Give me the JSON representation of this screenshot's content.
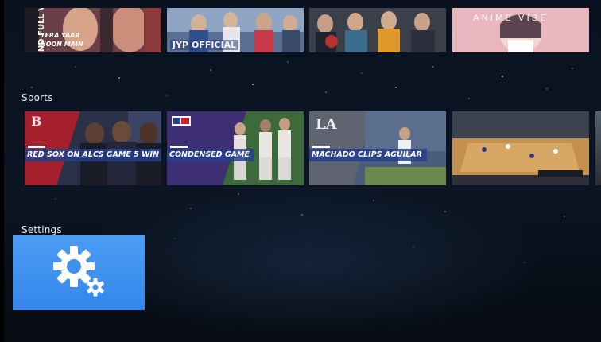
{
  "rows": [
    {
      "title": "",
      "tiles": [
        {
          "name": "movie-poster",
          "texts": [
            "ND FULL V",
            "TERA YAAR",
            "HOON MAIN"
          ]
        },
        {
          "name": "jyp-official",
          "texts": [
            "JYP OFFICIAL"
          ]
        },
        {
          "name": "group-video",
          "texts": []
        },
        {
          "name": "anime-vibe",
          "texts": [
            "ANIME VIBE"
          ]
        }
      ]
    },
    {
      "title": "Sports",
      "tiles": [
        {
          "name": "red-sox",
          "headline": "RED SOX ON ALCS GAME 5 WIN"
        },
        {
          "name": "condensed-game",
          "headline": "CONDENSED GAME"
        },
        {
          "name": "machado",
          "headline": "MACHADO CLIPS AGUILAR"
        },
        {
          "name": "basketball",
          "headline": ""
        }
      ]
    },
    {
      "title": "Settings",
      "tiles": [
        {
          "name": "settings",
          "icon": "gear-icon"
        }
      ]
    }
  ],
  "colors": {
    "settings_tile": "#3b8ef0",
    "headline_band": "#243e8c",
    "background": "#0a1220"
  }
}
